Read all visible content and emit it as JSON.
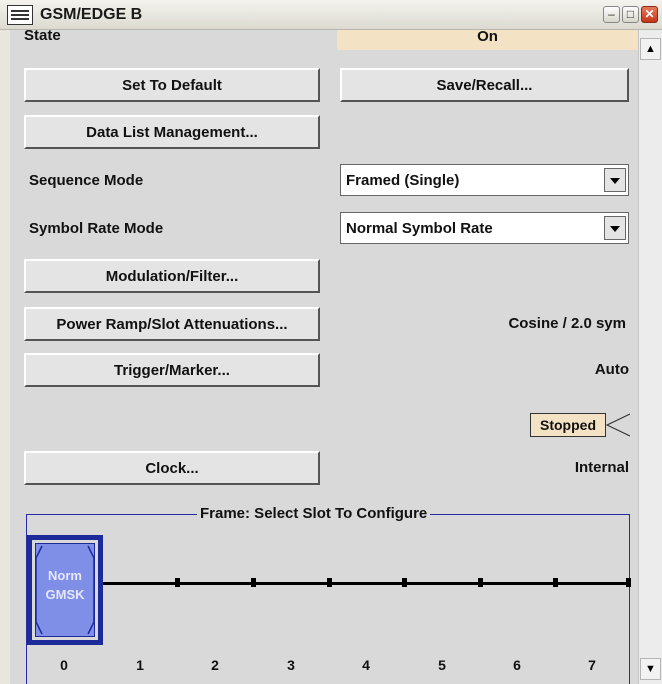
{
  "window": {
    "title": "GSM/EDGE B",
    "icon": "app-window-icon",
    "minimize_glyph": "–",
    "maximize_glyph": "□",
    "close_glyph": "✕"
  },
  "state": {
    "label": "State",
    "value": "On"
  },
  "buttons": {
    "set_default": "Set To Default",
    "save_recall": "Save/Recall...",
    "data_list": "Data List Management...",
    "modulation": "Modulation/Filter...",
    "power_ramp": "Power Ramp/Slot Attenuations...",
    "trigger": "Trigger/Marker...",
    "clock": "Clock..."
  },
  "sequence_mode": {
    "label": "Sequence Mode",
    "value": "Framed (Single)"
  },
  "symbol_rate_mode": {
    "label": "Symbol Rate Mode",
    "value": "Normal Symbol Rate"
  },
  "power_ramp_info": "Cosine /  2.0 sym",
  "trigger_info": "Auto",
  "marker_status": "Stopped",
  "clock_info": "Internal",
  "frame": {
    "title": "Frame: Select Slot To Configure",
    "slot0": {
      "line1": "Norm",
      "line2": "GMSK"
    },
    "slot_numbers": [
      "0",
      "1",
      "2",
      "3",
      "4",
      "5",
      "6",
      "7"
    ]
  },
  "scrollbar": {
    "up": "▲",
    "down": "▼"
  },
  "colors": {
    "panel": "#d9d9d9",
    "slot_fill": "#7f8fe7",
    "slot_border": "#1c2a9a",
    "status_fill": "#f3e2c4"
  }
}
